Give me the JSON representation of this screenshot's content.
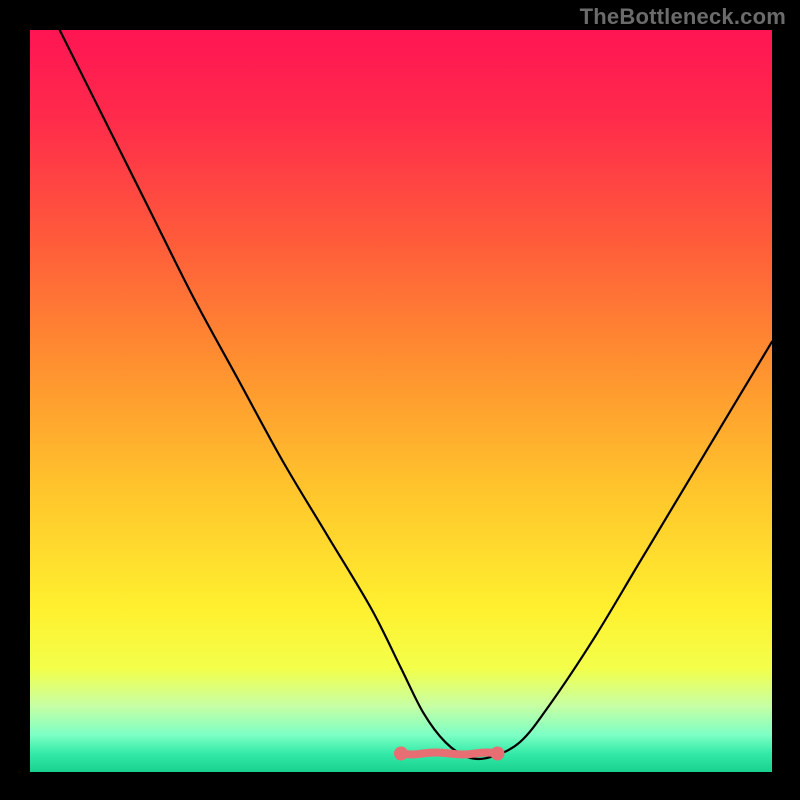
{
  "watermark": "TheBottleneck.com",
  "colors": {
    "page_bg": "#000000",
    "watermark": "#6b6b6b",
    "curve": "#000000",
    "trough_marker": "#e76e72",
    "gradient_stops": [
      {
        "offset": 0.0,
        "color": "#ff1553"
      },
      {
        "offset": 0.12,
        "color": "#ff2b4b"
      },
      {
        "offset": 0.28,
        "color": "#ff5a3b"
      },
      {
        "offset": 0.45,
        "color": "#ff9030"
      },
      {
        "offset": 0.62,
        "color": "#ffc52c"
      },
      {
        "offset": 0.78,
        "color": "#fff02f"
      },
      {
        "offset": 0.86,
        "color": "#f3ff4a"
      },
      {
        "offset": 0.91,
        "color": "#c8ffa3"
      },
      {
        "offset": 0.95,
        "color": "#7dffc5"
      },
      {
        "offset": 0.975,
        "color": "#34eaa8"
      },
      {
        "offset": 1.0,
        "color": "#19d18f"
      }
    ]
  },
  "chart_data": {
    "type": "line",
    "title": "",
    "xlabel": "",
    "ylabel": "",
    "xlim": [
      0,
      100
    ],
    "ylim": [
      0,
      100
    ],
    "grid": false,
    "legend": false,
    "series": [
      {
        "name": "bottleneck-curve",
        "x": [
          4,
          10,
          16,
          22,
          28,
          34,
          40,
          46,
          50,
          53,
          56,
          59,
          62,
          66,
          70,
          76,
          82,
          88,
          94,
          100
        ],
        "values": [
          100,
          88,
          76,
          64,
          53,
          42,
          32,
          22,
          14,
          8,
          4,
          2,
          2,
          4,
          9,
          18,
          28,
          38,
          48,
          58
        ]
      }
    ],
    "annotations": [
      {
        "name": "trough-band",
        "kind": "segment",
        "x_start": 50,
        "x_end": 63,
        "y": 2.5,
        "note": "flat zero-bottleneck trough with end dots"
      }
    ]
  }
}
